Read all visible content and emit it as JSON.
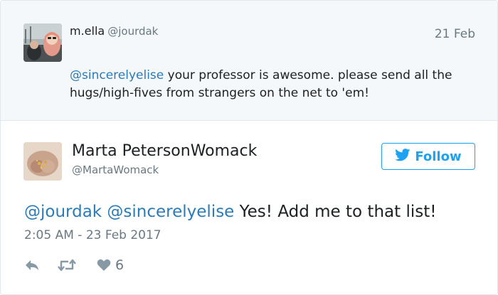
{
  "parent_tweet": {
    "display_name": "m.ella",
    "handle": "@jourdak",
    "date": "21 Feb",
    "text_mention": "@sincerelyelise",
    "text_body": " your professor is awesome. please send all the hugs/high-fives from strangers on the net to 'em!"
  },
  "main_tweet": {
    "display_name": "Marta PetersonWomack",
    "handle": "@MartaWomack",
    "follow_label": "Follow",
    "mention_1": "@jourdak",
    "mention_2": "@sincerelyelise",
    "text_body": " Yes! Add me to that list!",
    "timestamp": "2:05 AM - 23 Feb 2017",
    "like_count": "6"
  },
  "icons": {
    "follow": "twitter-bird-icon",
    "reply": "reply-icon",
    "retweet": "retweet-icon",
    "like": "heart-icon"
  },
  "colors": {
    "link": "#2b7bb9",
    "twitter_blue": "#1da1f2",
    "muted": "#697882",
    "parent_bg": "#f5f8fa"
  }
}
